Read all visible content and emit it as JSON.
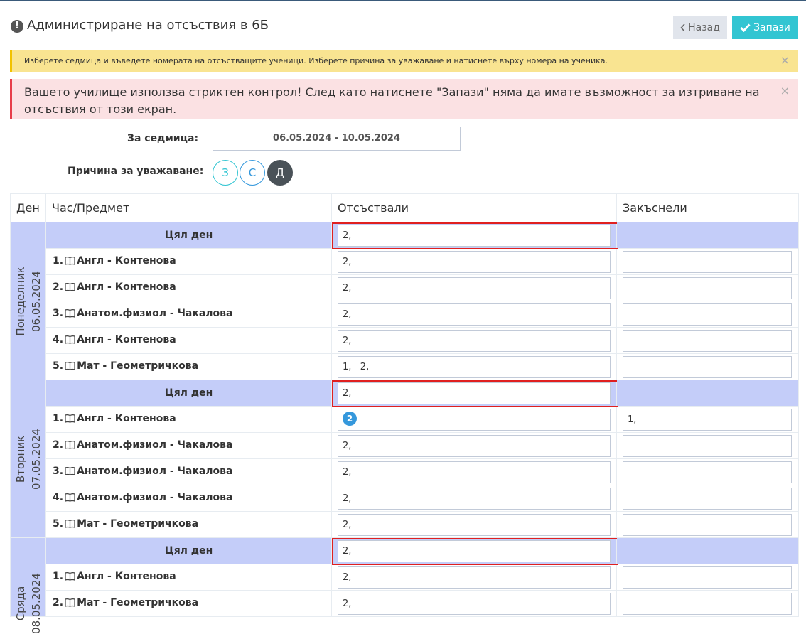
{
  "header": {
    "title": "Администриране на отсъствия в 6Б",
    "back_label": "Назад",
    "save_label": "Запази"
  },
  "alerts": {
    "info": "Изберете седмица и въведете номерата на отсъстващите ученици. Изберете причина за уважаване и натиснете върху номера на ученика.",
    "warning": "Вашето училище използва стриктен контрол! След като натиснете \"Запази\" няма да имате възможност за изтриване на отсъствия от този екран.",
    "close_symbol": "×"
  },
  "form": {
    "week_label": "За седмица:",
    "week_value": "06.05.2024 - 10.05.2024",
    "reason_label": "Причина за уважаване:",
    "reasons": [
      "З",
      "С",
      "Д"
    ],
    "active_reason": "Д"
  },
  "table": {
    "headers": [
      "Ден",
      "Час/Предмет",
      "Отсъствали",
      "Закъснели"
    ],
    "full_day_label": "Цял ден",
    "days": [
      {
        "name": "Понеделник",
        "date": "06.05.2024",
        "full_day_absent": "2,",
        "lessons": [
          {
            "num": "1.",
            "subject": "Англ - Контенова",
            "absent": "2,",
            "late": ""
          },
          {
            "num": "2.",
            "subject": "Англ - Контенова",
            "absent": "2,",
            "late": ""
          },
          {
            "num": "3.",
            "subject": "Анатом.физиол - Чакалова",
            "absent": "2,",
            "late": ""
          },
          {
            "num": "4.",
            "subject": "Англ - Контенова",
            "absent": "2,",
            "late": ""
          },
          {
            "num": "5.",
            "subject": "Мат - Геометричкова",
            "absent": "1,   2,",
            "late": ""
          }
        ]
      },
      {
        "name": "Вторник",
        "date": "07.05.2024",
        "full_day_absent": "2,",
        "lessons": [
          {
            "num": "1.",
            "subject": "Англ - Контенова",
            "absent_badge": "2",
            "late": "1,"
          },
          {
            "num": "2.",
            "subject": "Анатом.физиол - Чакалова",
            "absent": "2,",
            "late": ""
          },
          {
            "num": "3.",
            "subject": "Анатом.физиол - Чакалова",
            "absent": "2,",
            "late": ""
          },
          {
            "num": "4.",
            "subject": "Анатом.физиол - Чакалова",
            "absent": "2,",
            "late": ""
          },
          {
            "num": "5.",
            "subject": "Мат - Геометричкова",
            "absent": "2,",
            "late": ""
          }
        ]
      },
      {
        "name": "Сряда",
        "date": "08.05.2024",
        "full_day_absent": "2,",
        "lessons": [
          {
            "num": "1.",
            "subject": "Англ - Контенова",
            "absent": "2,",
            "late": ""
          },
          {
            "num": "2.",
            "subject": "Мат - Геометричкова",
            "absent": "2,",
            "late": ""
          }
        ]
      }
    ]
  },
  "colors": {
    "accent": "#32c5d2",
    "day_band": "#c4cdf9",
    "highlight": "#e02020",
    "badge": "#3598dc"
  }
}
